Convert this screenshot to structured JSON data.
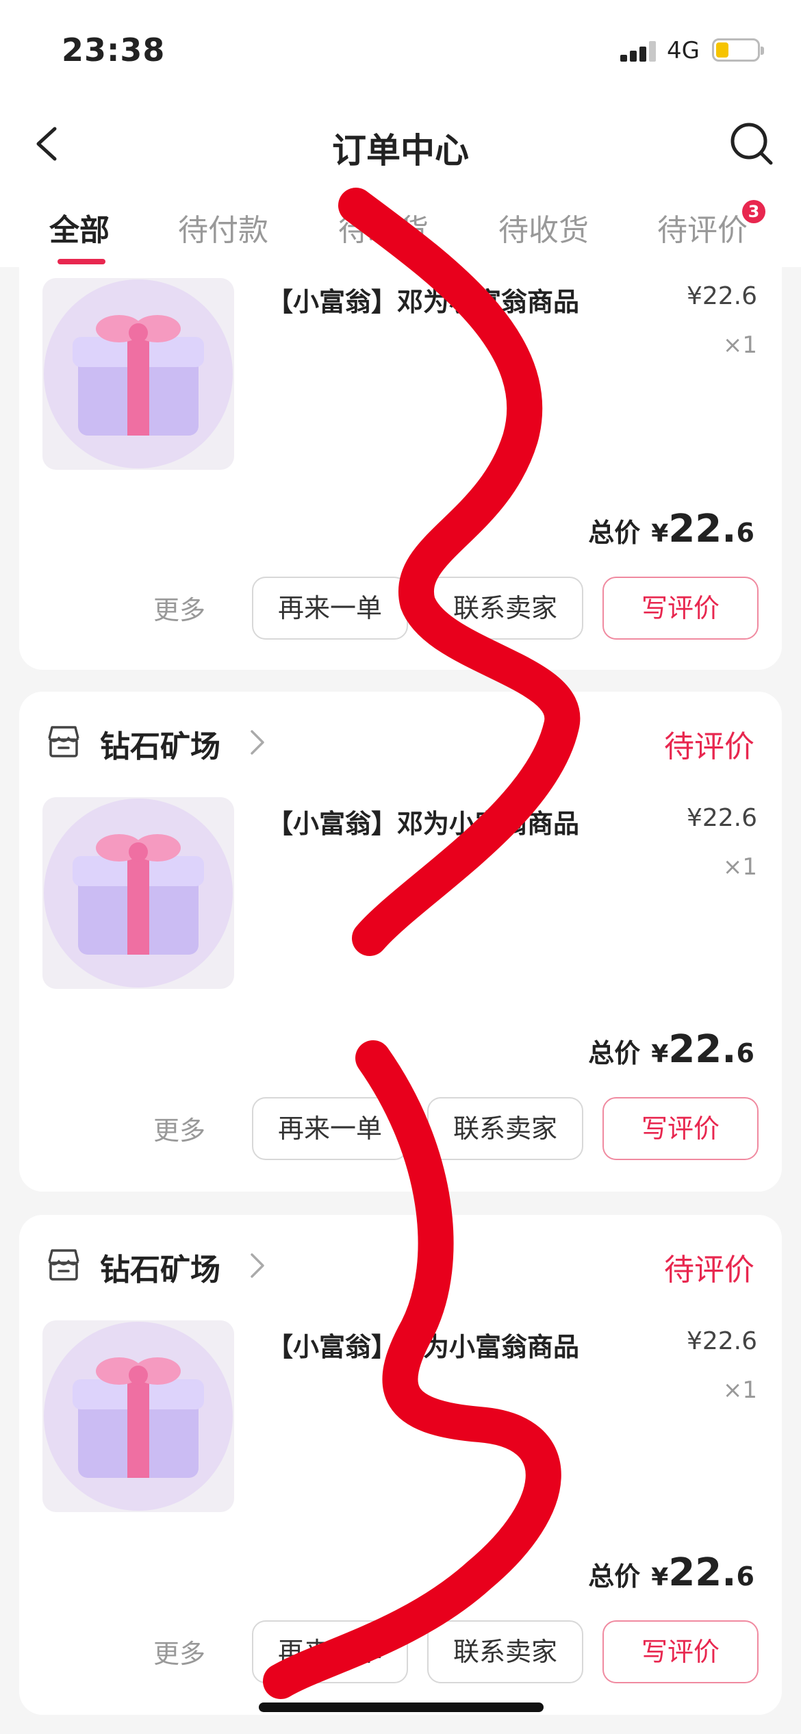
{
  "status_bar": {
    "time": "23:38",
    "network": "4G"
  },
  "nav": {
    "title": "订单中心"
  },
  "tabs": [
    {
      "label": "全部",
      "active": true
    },
    {
      "label": "待付款"
    },
    {
      "label": "待发货"
    },
    {
      "label": "待收货"
    },
    {
      "label": "待评价",
      "badge": "3"
    }
  ],
  "orders": [
    {
      "product": "【小富翁】邓为小富翁商品",
      "price": "¥22.6",
      "qty": "×1",
      "total_label": "总价",
      "total_currency": "¥",
      "total_int": "22.",
      "total_dec": "6",
      "more": "更多",
      "buttons": [
        "再来一单",
        "联系卖家",
        "写评价"
      ]
    },
    {
      "shop": "钻石矿场",
      "status": "待评价",
      "product": "【小富翁】邓为小富翁商品",
      "price": "¥22.6",
      "qty": "×1",
      "total_label": "总价",
      "total_currency": "¥",
      "total_int": "22.",
      "total_dec": "6",
      "more": "更多",
      "buttons": [
        "再来一单",
        "联系卖家",
        "写评价"
      ]
    },
    {
      "shop": "钻石矿场",
      "status": "待评价",
      "product": "【小富翁】邓为小富翁商品",
      "price": "¥22.6",
      "qty": "×1",
      "total_label": "总价",
      "total_currency": "¥",
      "total_int": "22.",
      "total_dec": "6",
      "more": "更多",
      "buttons": [
        "再来一单",
        "联系卖家",
        "写评价"
      ]
    }
  ],
  "colors": {
    "accent": "#e8274f",
    "scribble": "#e8001c",
    "battery": "#f6c400"
  },
  "icons": [
    "back-arrow-icon",
    "search-icon",
    "shop-icon",
    "chevron-right-icon",
    "gift-box-icon",
    "signal-icon",
    "battery-icon"
  ]
}
